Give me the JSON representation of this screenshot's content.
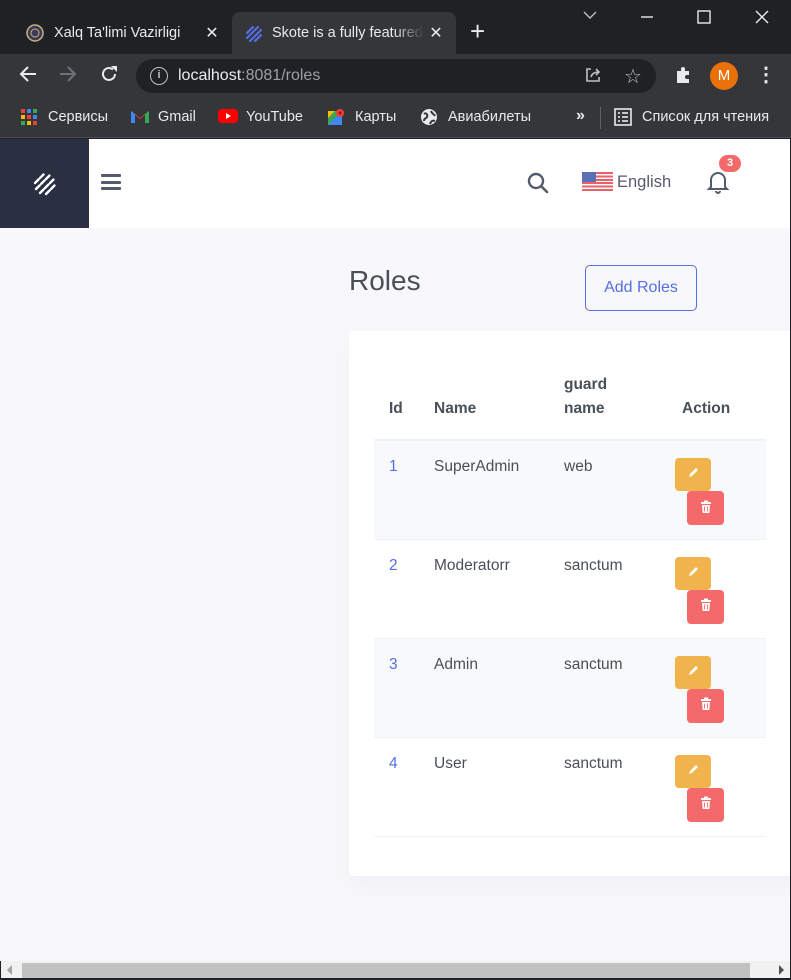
{
  "browser": {
    "tabs": [
      {
        "title": "Xalq Ta'limi Vazirligi",
        "active": false,
        "icon": "emblem-icon"
      },
      {
        "title": "Skote is a fully featured",
        "active": true,
        "icon": "skote-logo-icon"
      }
    ],
    "close_glyph": "✕",
    "new_tab_glyph": "+",
    "window_controls": {
      "tab_search": "⌵",
      "minimize": "—",
      "maximize": "☐",
      "close": "✕"
    },
    "url_host": "localhost",
    "url_rest": ":8081/roles",
    "avatar_letter": "M",
    "bookmarks": [
      {
        "label": "Сервисы",
        "icon": "apps-grid-icon"
      },
      {
        "label": "Gmail",
        "icon": "gmail-icon"
      },
      {
        "label": "YouTube",
        "icon": "youtube-icon"
      },
      {
        "label": "Карты",
        "icon": "maps-icon"
      },
      {
        "label": "Авиабилеты",
        "icon": "globe-icon"
      }
    ],
    "bookmarks_more": "»",
    "reading_list": "Список для чтения"
  },
  "header": {
    "language": "English",
    "notification_count": "3"
  },
  "main": {
    "title": "Roles",
    "add_button": "Add Roles",
    "table": {
      "columns": [
        "Id",
        "Name",
        "guard name",
        "Action"
      ],
      "rows": [
        {
          "id": "1",
          "name": "SuperAdmin",
          "guard": "web"
        },
        {
          "id": "2",
          "name": "Moderatorr",
          "guard": "sanctum"
        },
        {
          "id": "3",
          "name": "Admin",
          "guard": "sanctum"
        },
        {
          "id": "4",
          "name": "User",
          "guard": "sanctum"
        }
      ]
    }
  },
  "colors": {
    "primary": "#556ee6",
    "warning": "#f1b44c",
    "danger": "#f46a6a",
    "sidebar": "#2a3042"
  }
}
